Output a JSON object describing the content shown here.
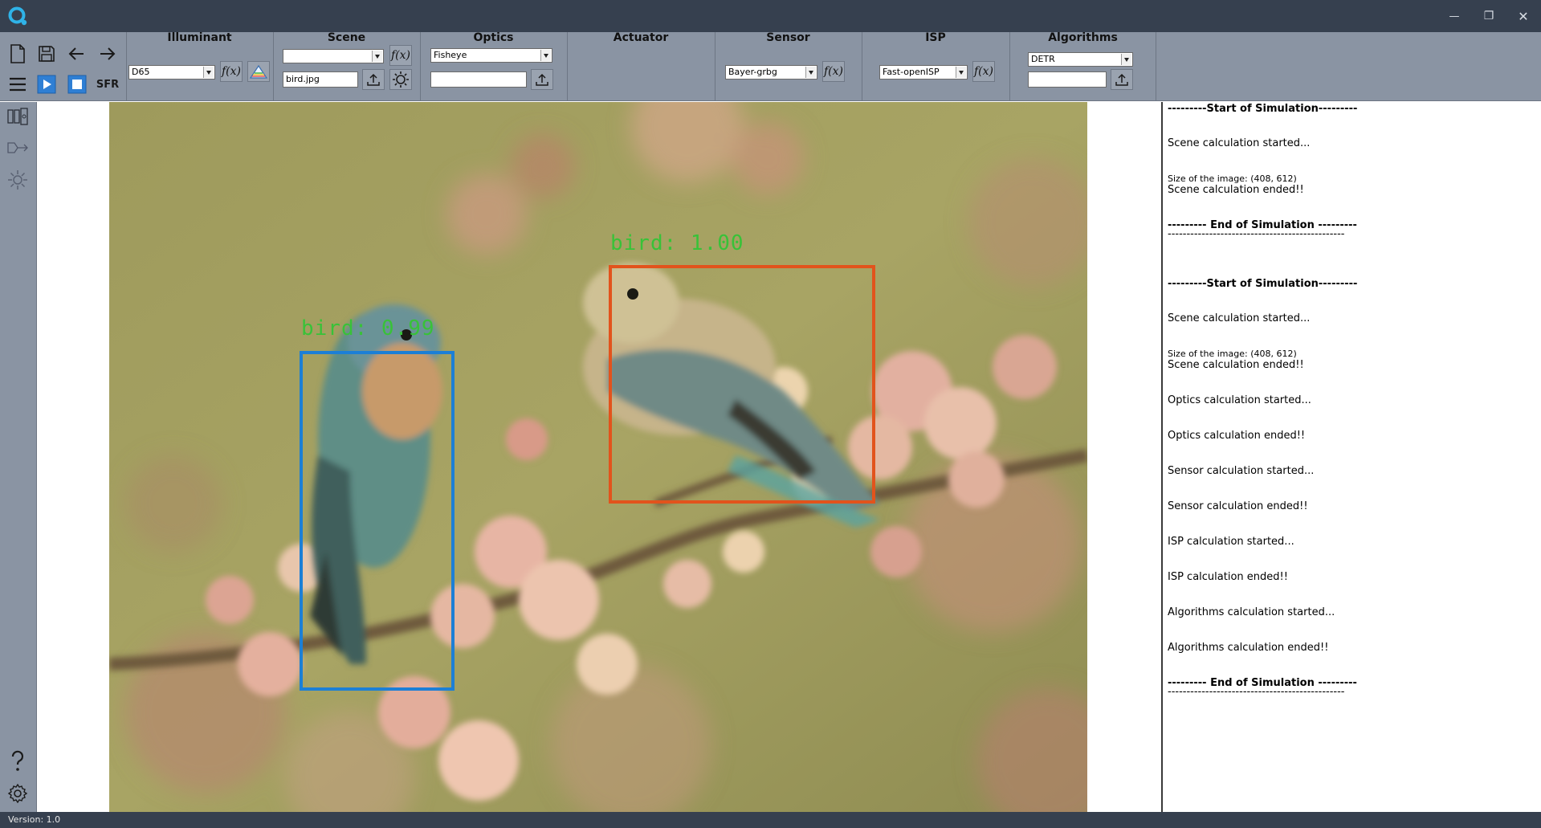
{
  "window": {
    "minimize_glyph": "—",
    "restore_glyph": "❐",
    "close_glyph": "✕"
  },
  "toolbar": {
    "sfr_label": "SFR",
    "sections": {
      "illuminant": {
        "title": "Illuminant",
        "dropdown_value": "D65"
      },
      "scene": {
        "title": "Scene",
        "dropdown_value": "",
        "file_value": "bird.jpg"
      },
      "optics": {
        "title": "Optics",
        "dropdown_value": "Fisheye",
        "file_value": ""
      },
      "actuator": {
        "title": "Actuator"
      },
      "sensor": {
        "title": "Sensor",
        "dropdown_value": "Bayer-grbg"
      },
      "isp": {
        "title": "ISP",
        "dropdown_value": "Fast-openISP"
      },
      "algorithms": {
        "title": "Algorithms",
        "dropdown_value": "DETR",
        "file_value": ""
      }
    },
    "fx_label": "f(x)"
  },
  "detections": [
    {
      "label": "bird: 0.99",
      "color": "#1c7fd6"
    },
    {
      "label": "bird: 1.00",
      "color": "#e2531c"
    }
  ],
  "log": [
    {
      "text": "---------Start of Simulation---------",
      "style": "bold"
    },
    {
      "text": "Scene calculation started...",
      "style": "normal"
    },
    {
      "text": "Size of the image: (408, 612)",
      "style": "small"
    },
    {
      "text": "Scene calculation ended!!",
      "style": "normal"
    },
    {
      "text": "--------- End of Simulation ---------",
      "style": "bold"
    },
    {
      "text": "-----------------------------------------------",
      "style": "normal"
    },
    {
      "text": "---------Start of Simulation---------",
      "style": "bold"
    },
    {
      "text": "Scene calculation started...",
      "style": "normal"
    },
    {
      "text": "Size of the image: (408, 612)",
      "style": "small"
    },
    {
      "text": "Scene calculation ended!!",
      "style": "normal"
    },
    {
      "text": "Optics calculation started...",
      "style": "normal"
    },
    {
      "text": "Optics calculation ended!!",
      "style": "normal"
    },
    {
      "text": "Sensor calculation started...",
      "style": "normal"
    },
    {
      "text": "Sensor calculation ended!!",
      "style": "normal"
    },
    {
      "text": "ISP calculation started...",
      "style": "normal"
    },
    {
      "text": "ISP calculation ended!!",
      "style": "normal"
    },
    {
      "text": "Algorithms calculation started...",
      "style": "normal"
    },
    {
      "text": "Algorithms calculation ended!!",
      "style": "normal"
    },
    {
      "text": "--------- End of Simulation ---------",
      "style": "bold"
    },
    {
      "text": "-----------------------------------------------",
      "style": "normal"
    }
  ],
  "status": {
    "version": "Version: 1.0"
  },
  "icons": [
    "app-logo-icon",
    "new-file-icon",
    "save-icon",
    "undo-arrow-icon",
    "redo-arrow-icon",
    "menu-icon",
    "play-icon",
    "stop-icon",
    "prism-icon",
    "upload-icon",
    "sun-icon",
    "modules-icon",
    "pipeline-icon",
    "gear-sun-icon",
    "help-icon",
    "settings-icon"
  ]
}
